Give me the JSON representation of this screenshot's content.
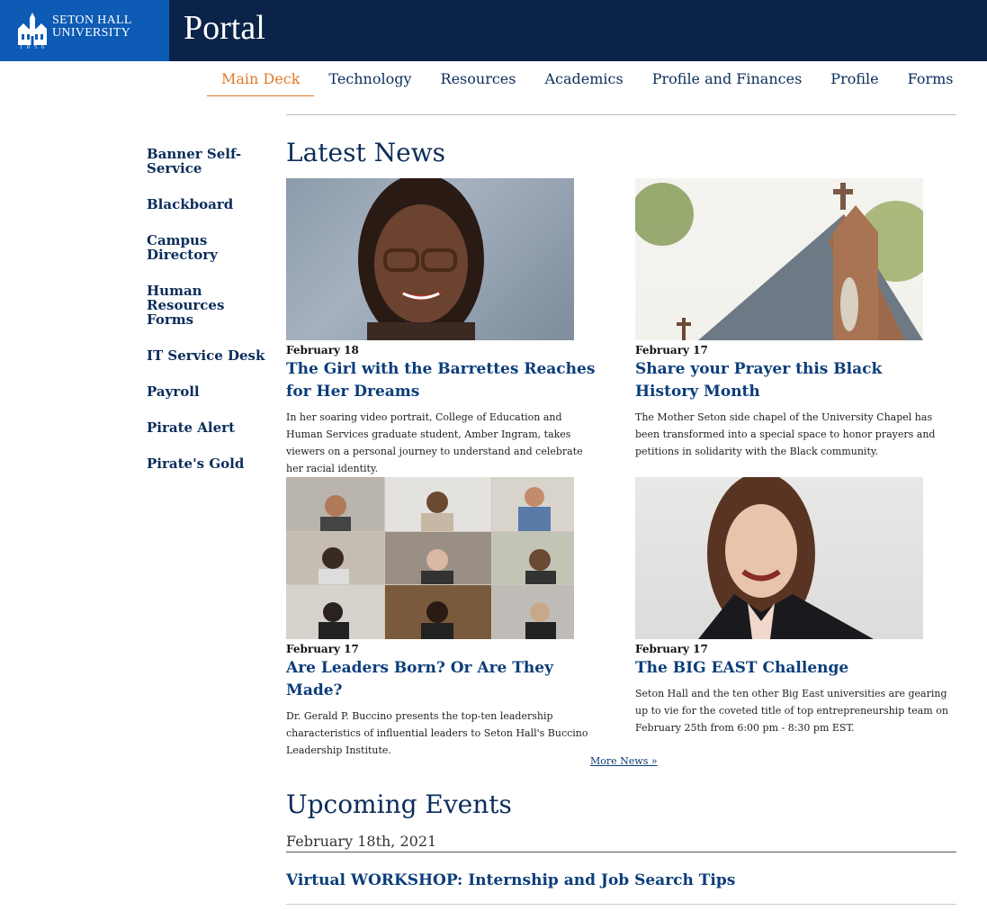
{
  "header": {
    "logo_line1": "SETON HALL",
    "logo_line2": "UNIVERSITY",
    "logo_year": "1856",
    "title": "Portal"
  },
  "nav": {
    "items": [
      {
        "label": "Main Deck",
        "active": true
      },
      {
        "label": "Technology"
      },
      {
        "label": "Resources"
      },
      {
        "label": "Academics"
      },
      {
        "label": "Profile and Finances"
      },
      {
        "label": "Profile"
      },
      {
        "label": "Forms"
      }
    ]
  },
  "sidebar": {
    "items": [
      {
        "label": "Banner Self-Service"
      },
      {
        "label": "Blackboard"
      },
      {
        "label": "Campus Directory"
      },
      {
        "label": "Human Resources Forms"
      },
      {
        "label": "IT Service Desk"
      },
      {
        "label": "Payroll"
      },
      {
        "label": "Pirate Alert"
      },
      {
        "label": "Pirate's Gold"
      }
    ]
  },
  "news": {
    "heading": "Latest News",
    "items": [
      {
        "date": "February 18",
        "title": "The Girl with the Barrettes Reaches for Her Dreams",
        "summary": "In her soaring video portrait, College of Education and Human Services graduate student, Amber Ingram, takes viewers on a personal journey to understand and celebrate her racial identity."
      },
      {
        "date": "February 17",
        "title": "Share your Prayer this Black History Month",
        "summary": "The Mother Seton side chapel of the University Chapel has been transformed into a special space to honor prayers and petitions in solidarity with the Black community."
      },
      {
        "date": "February 17",
        "title": "Are Leaders Born? Or Are They Made?",
        "summary": "Dr. Gerald P. Buccino presents the top-ten leadership characteristics of influential leaders to Seton Hall's Buccino Leadership Institute."
      },
      {
        "date": "February 17",
        "title": "The BIG EAST Challenge",
        "summary": "Seton Hall and the ten other Big East universities are gearing up to vie for the coveted title of top entrepreneurship team on February 25th from 6:00 pm - 8:30 pm EST."
      }
    ],
    "more_label": "More News »"
  },
  "events": {
    "heading": "Upcoming Events",
    "date": "February 18th, 2021",
    "items": [
      {
        "title": "Virtual WORKSHOP: Internship and Job Search Tips"
      }
    ]
  }
}
